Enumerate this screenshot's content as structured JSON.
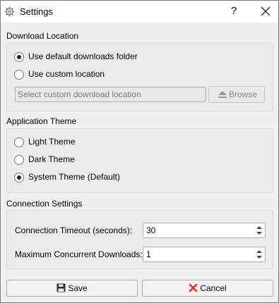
{
  "window": {
    "title": "Settings",
    "help_label": "?"
  },
  "download_location": {
    "section_title": "Download Location",
    "options": [
      {
        "label": "Use default downloads folder",
        "selected": true
      },
      {
        "label": "Use custom location",
        "selected": false
      }
    ],
    "path_placeholder": "Select custom download location",
    "browse_label": "Browse"
  },
  "application_theme": {
    "section_title": "Application Theme",
    "options": [
      {
        "label": "Light Theme",
        "selected": false
      },
      {
        "label": "Dark Theme",
        "selected": false
      },
      {
        "label": "System Theme (Default)",
        "selected": true
      }
    ]
  },
  "connection_settings": {
    "section_title": "Connection Settings",
    "timeout": {
      "label": "Connection Timeout (seconds):",
      "value": "30"
    },
    "max_downloads": {
      "label": "Maximum Concurrent Downloads:",
      "value": "1"
    }
  },
  "footer": {
    "save_label": "Save",
    "cancel_label": "Cancel"
  },
  "icons": {
    "app": "gear-icon",
    "close": "close-icon",
    "browse": "eject-icon",
    "save": "floppy-disk-icon",
    "cancel": "red-x-icon",
    "spin": "up-down-arrows-icon"
  },
  "colors": {
    "cancel_icon": "#d9342b",
    "save_icon": "#2b2b2b",
    "group_bg": "#ececec"
  }
}
